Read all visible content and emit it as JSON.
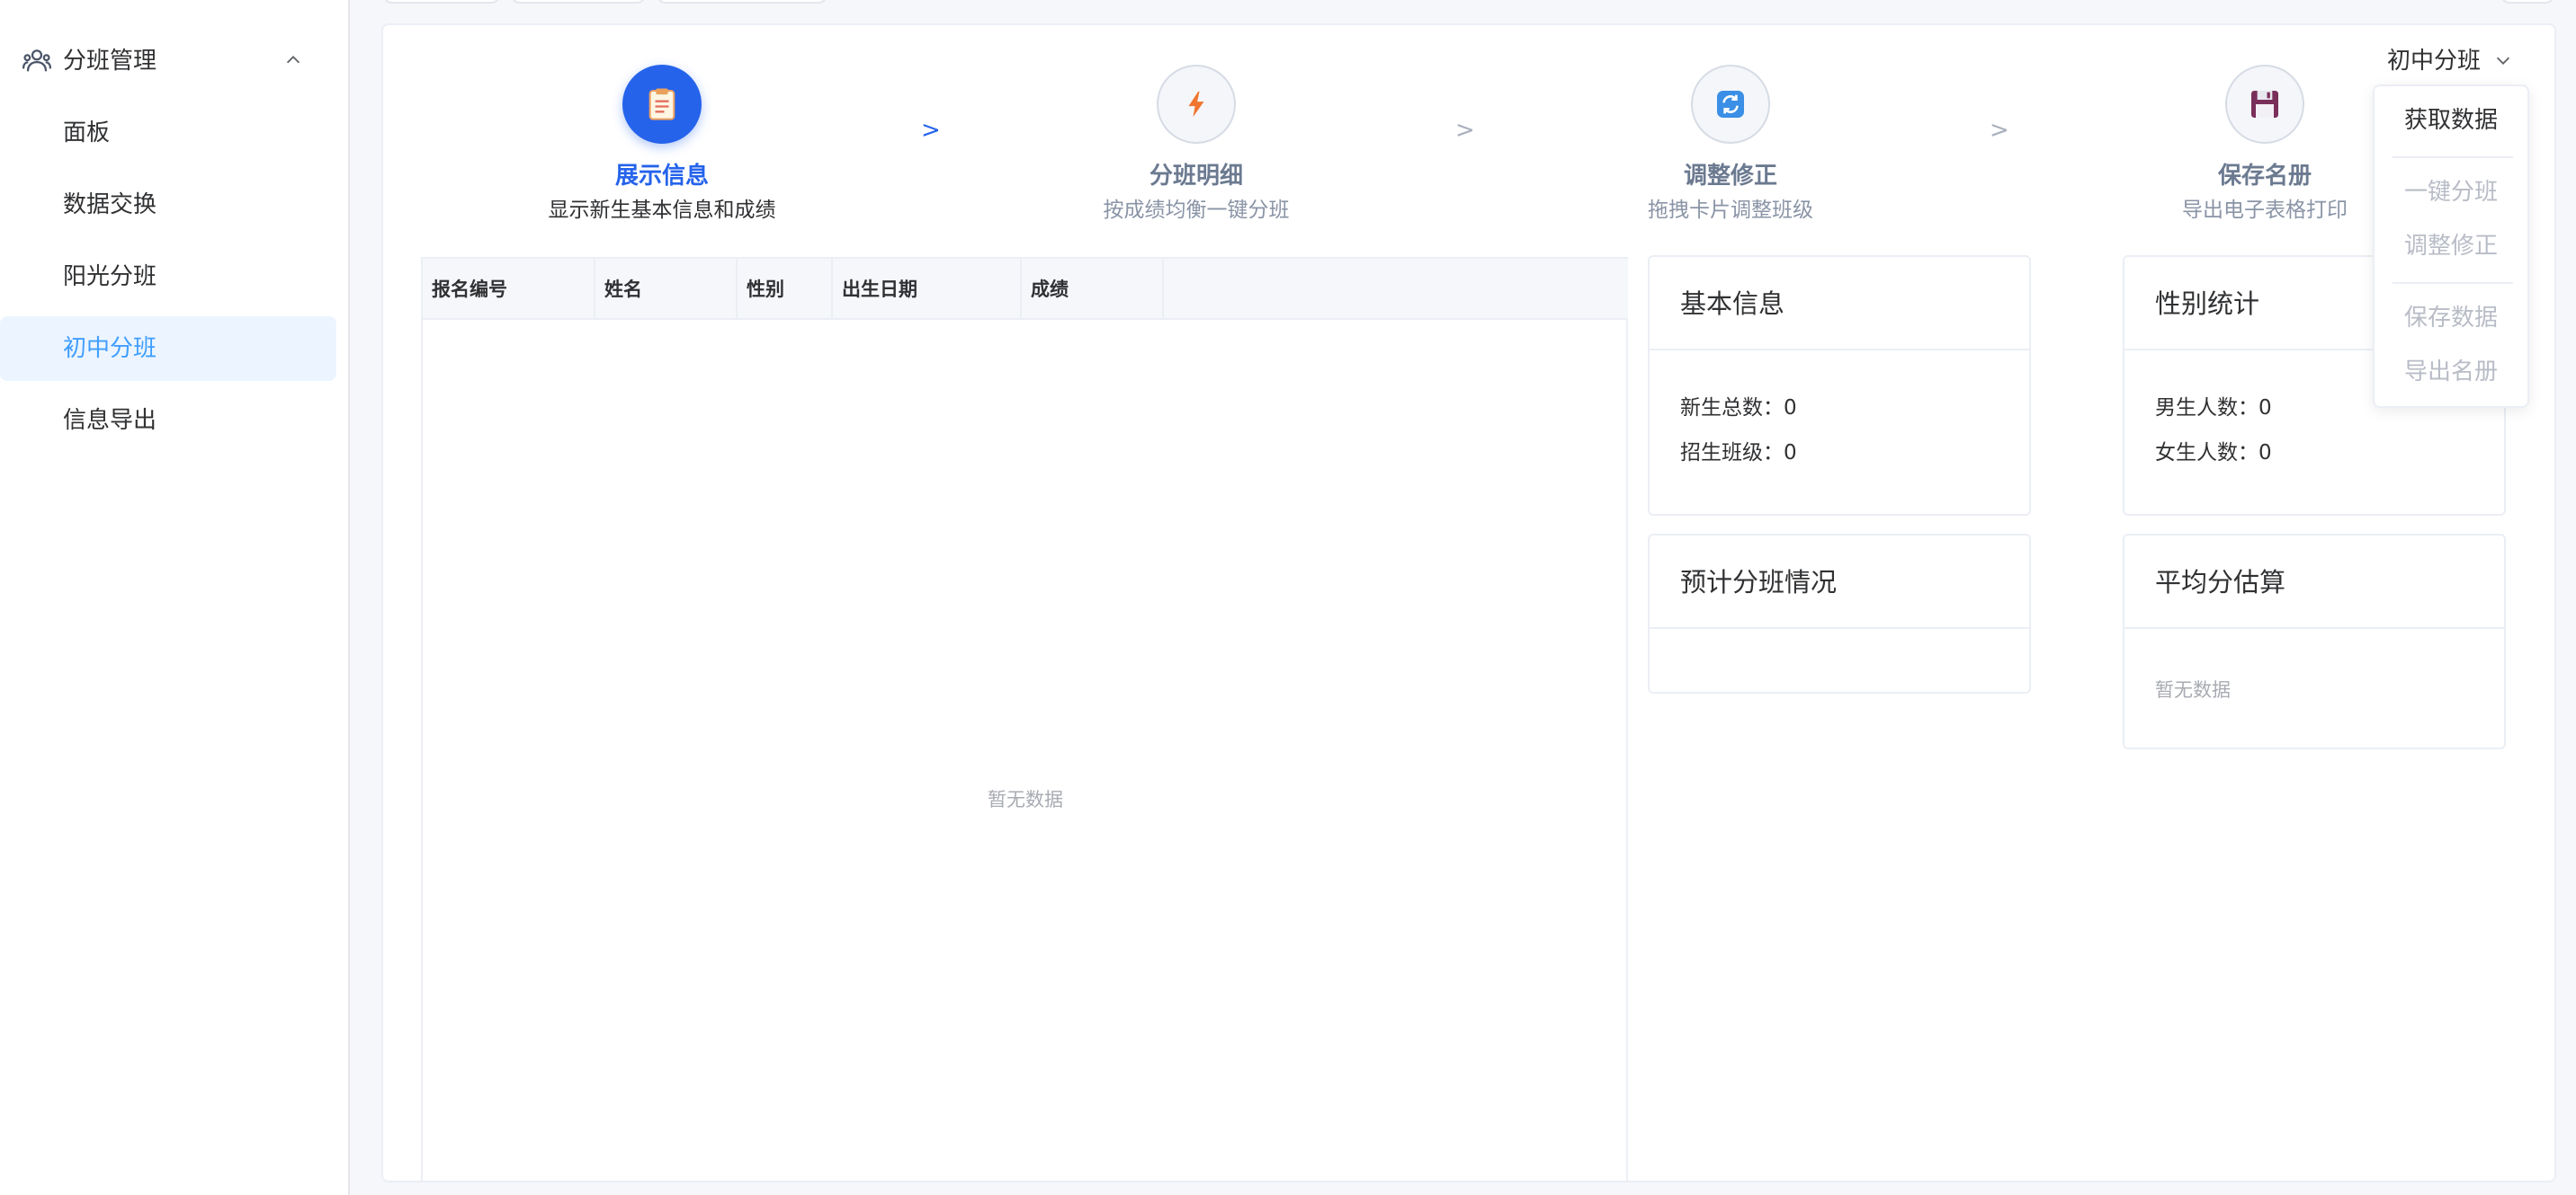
{
  "sidebar": {
    "group_label": "分班管理",
    "items": [
      {
        "label": "面板"
      },
      {
        "label": "数据交换"
      },
      {
        "label": "阳光分班"
      },
      {
        "label": "初中分班"
      },
      {
        "label": "信息导出"
      }
    ]
  },
  "steps": [
    {
      "title": "展示信息",
      "desc": "显示新生基本信息和成绩",
      "icon": "clipboard-icon"
    },
    {
      "title": "分班明细",
      "desc": "按成绩均衡一键分班",
      "icon": "lightning-icon"
    },
    {
      "title": "调整修正",
      "desc": "拖拽卡片调整班级",
      "icon": "refresh-icon"
    },
    {
      "title": "保存名册",
      "desc": "导出电子表格打印",
      "icon": "floppy-disk-icon"
    }
  ],
  "step_arrow": ">",
  "table": {
    "columns": [
      "报名编号",
      "姓名",
      "性别",
      "出生日期",
      "成绩"
    ],
    "empty_text": "暂无数据"
  },
  "cards": {
    "basic": {
      "title": "基本信息",
      "rows": [
        {
          "label": "新生总数：",
          "value": "0"
        },
        {
          "label": "招生班级：",
          "value": "0"
        }
      ]
    },
    "gender": {
      "title": "性别统计",
      "rows": [
        {
          "label": "男生人数：",
          "value": "0"
        },
        {
          "label": "女生人数：",
          "value": "0"
        }
      ]
    },
    "forecast": {
      "title": "预计分班情况"
    },
    "average": {
      "title": "平均分估算",
      "empty_text": "暂无数据"
    }
  },
  "dropdown": {
    "trigger_label": "初中分班",
    "items": [
      {
        "label": "获取数据",
        "enabled": true
      },
      {
        "label": "一键分班",
        "enabled": false
      },
      {
        "label": "调整修正",
        "enabled": false
      },
      {
        "label": "保存数据",
        "enabled": false
      },
      {
        "label": "导出名册",
        "enabled": false
      }
    ]
  },
  "colors": {
    "accent": "#2563eb",
    "active_menu_bg": "#ecf5ff",
    "active_menu_text": "#409eff"
  }
}
